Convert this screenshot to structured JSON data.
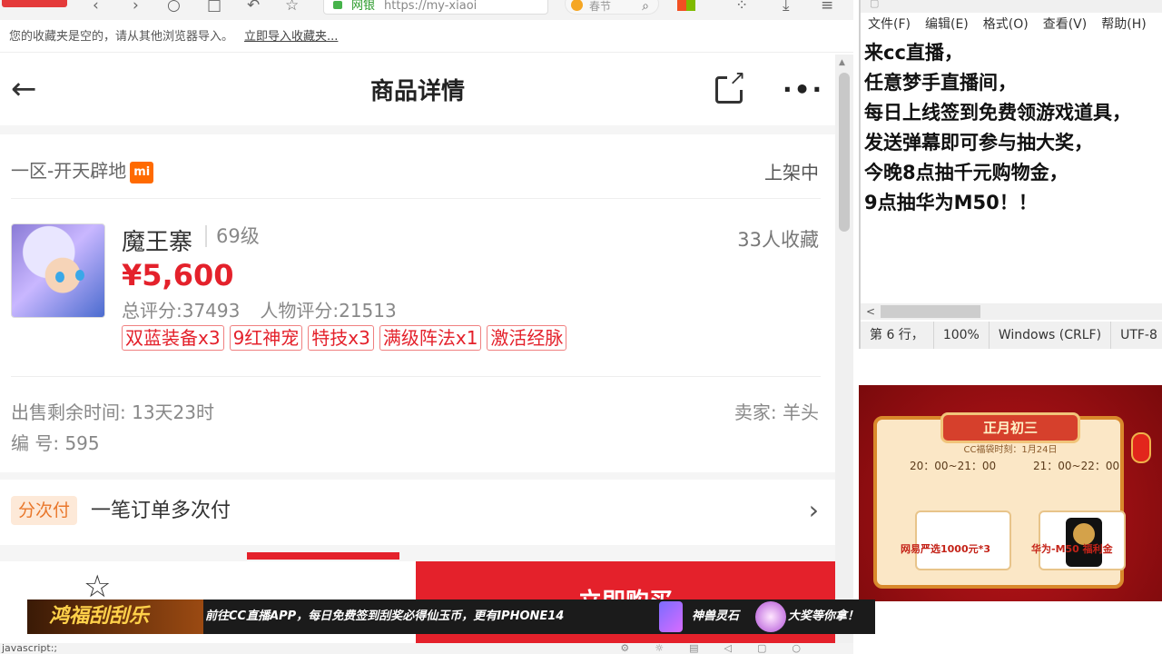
{
  "browser": {
    "bookmark_notice": "您的收藏夹是空的，请从其他浏览器导入。",
    "import_link": "立即导入收藏夹...",
    "address_label": "网银",
    "address_url": "https://my-xiaoi",
    "search_placeholder": "春节"
  },
  "page": {
    "title": "商品详情",
    "server": "一区-开天辟地",
    "server_badge": "mi",
    "status": "上架中",
    "name": "魔王寨",
    "level": "69级",
    "favorites": "33人收藏",
    "price": "¥5,600",
    "total_score": "总评分:37493",
    "role_score": "人物评分:21513",
    "tags": [
      "双蓝装备x3",
      "9红神宠",
      "特技x3",
      "满级阵法x1",
      "激活经脉"
    ],
    "remaining": "出售剩余时间: 13天23时",
    "seller": "卖家: 羊头",
    "serial": "编 号: 595",
    "installment_badge": "分次付",
    "installment_text": "一笔订单多次付",
    "buy_label": "立即购买"
  },
  "statusbar": {
    "text": "javascript:;"
  },
  "notepad": {
    "menu": [
      "文件(F)",
      "编辑(E)",
      "格式(O)",
      "查看(V)",
      "帮助(H)"
    ],
    "lines": [
      "来cc直播，",
      "任意梦手直播间，",
      "每日上线签到免费领游戏道具，",
      "发送弹幕即可参与抽大奖，",
      "今晚8点抽千元购物金，",
      "9点抽华为M50！！"
    ],
    "status": {
      "position": "第 6 行，",
      "zoom": "100%",
      "eol": "Windows (CRLF)",
      "encoding": "UTF-8"
    }
  },
  "promo": {
    "header": "正月初三",
    "subtitle": "CC福袋时刻：1月24日",
    "time1": "20：00~21：00",
    "time2": "21：00~22：00",
    "label1": "网易严选1000元*3",
    "label2": "华为-M50 福利金"
  },
  "banner": {
    "logo": "鸿福刮刮乐",
    "text": "前往CC直播APP，每日免费签到刮奖必得仙玉币，更有IPHONE14",
    "text2": "神兽灵石",
    "text3": "大奖等你拿！"
  },
  "colors": {
    "accent_red": "#e4212b",
    "installment_orange": "#e9772b"
  }
}
